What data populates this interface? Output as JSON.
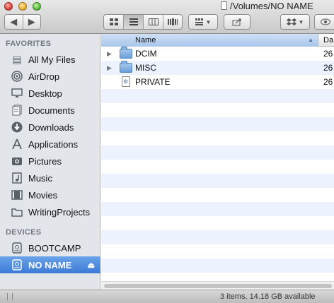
{
  "window": {
    "title": "/Volumes/NO NAME"
  },
  "toolbar": {
    "back_icon": "chevron-left",
    "forward_icon": "chevron-right",
    "view_icons": [
      "icon-view",
      "list-view",
      "column-view",
      "coverflow-view"
    ],
    "arrange_icon": "grid-arrange",
    "share_icon": "share",
    "dropbox_icon": "dropbox",
    "quicklook_icon": "eye"
  },
  "sidebar": {
    "favorites_heading": "FAVORITES",
    "favorites": [
      {
        "label": "All My Files",
        "icon": "all-files-icon"
      },
      {
        "label": "AirDrop",
        "icon": "airdrop-icon"
      },
      {
        "label": "Desktop",
        "icon": "desktop-icon"
      },
      {
        "label": "Documents",
        "icon": "documents-icon"
      },
      {
        "label": "Downloads",
        "icon": "downloads-icon"
      },
      {
        "label": "Applications",
        "icon": "applications-icon"
      },
      {
        "label": "Pictures",
        "icon": "pictures-icon"
      },
      {
        "label": "Music",
        "icon": "music-icon"
      },
      {
        "label": "Movies",
        "icon": "movies-icon"
      },
      {
        "label": "WritingProjects",
        "icon": "folder-icon"
      }
    ],
    "devices_heading": "DEVICES",
    "devices": [
      {
        "label": "BOOTCAMP",
        "icon": "drive-icon"
      },
      {
        "label": "NO NAME",
        "icon": "drive-icon",
        "selected": true
      }
    ]
  },
  "list": {
    "columns": {
      "name": "Name",
      "date": "Da"
    },
    "rows": [
      {
        "name": "DCIM",
        "date": "26",
        "type": "folder",
        "expandable": true
      },
      {
        "name": "MISC",
        "date": "26",
        "type": "folder",
        "expandable": true
      },
      {
        "name": "PRIVATE",
        "date": "26",
        "type": "file",
        "expandable": false
      }
    ]
  },
  "status": {
    "text": "3 items, 14.18 GB available"
  },
  "colors": {
    "selection": "#3b7ad6",
    "sidebar_bg": "#e2e6eb",
    "stripe": "#edf3fe"
  }
}
